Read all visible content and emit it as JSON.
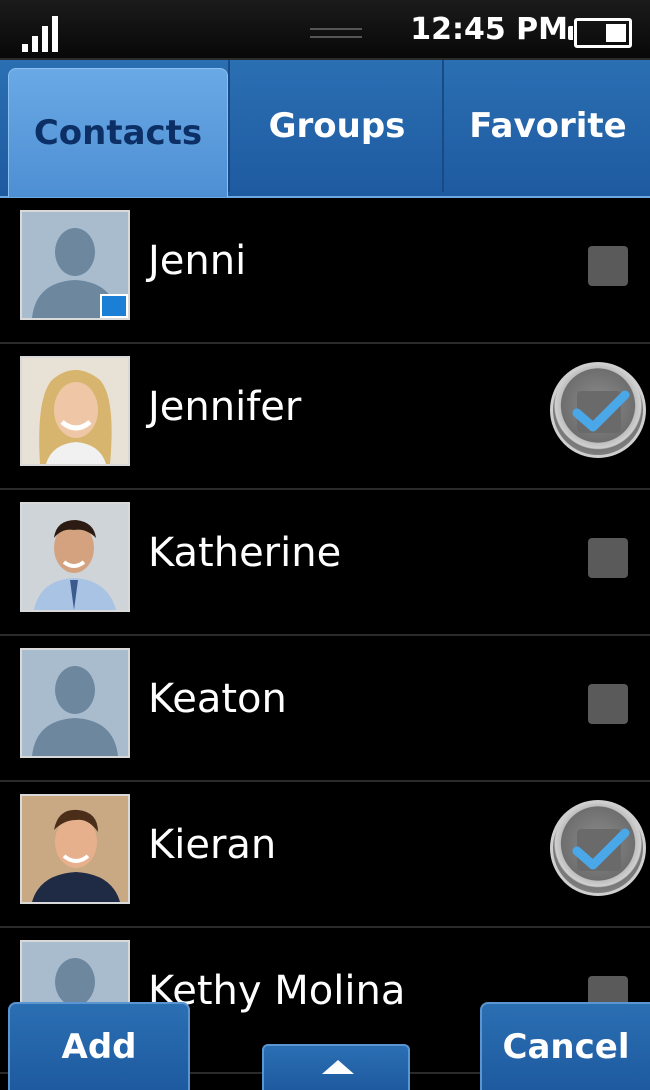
{
  "status_bar": {
    "time": "12:45 PM",
    "signal_icon": "signal-icon",
    "battery_icon": "battery-icon"
  },
  "tabs": [
    {
      "label": "Contacts",
      "active": true
    },
    {
      "label": "Groups",
      "active": false
    },
    {
      "label": "Favorite",
      "active": false
    }
  ],
  "contacts": [
    {
      "name": "Jenni",
      "checked": false,
      "avatar": "default-silhouette",
      "sim": true
    },
    {
      "name": "Jennifer",
      "checked": true,
      "avatar": "photo-woman"
    },
    {
      "name": "Katherine",
      "checked": false,
      "avatar": "photo-man-dark-hair"
    },
    {
      "name": "Keaton",
      "checked": false,
      "avatar": "default-silhouette"
    },
    {
      "name": "Kieran",
      "checked": true,
      "avatar": "photo-man-brown-hair"
    },
    {
      "name": "Kethy Molina",
      "checked": false,
      "avatar": "default-silhouette"
    }
  ],
  "bottom_bar": {
    "add_label": "Add",
    "cancel_label": "Cancel",
    "up_icon": "chevron-up-icon"
  },
  "colors": {
    "tab_blue": "#2b6fb3",
    "tab_active": "#5a9bdc",
    "check_blue": "#4aa8e8",
    "background": "#000000"
  }
}
